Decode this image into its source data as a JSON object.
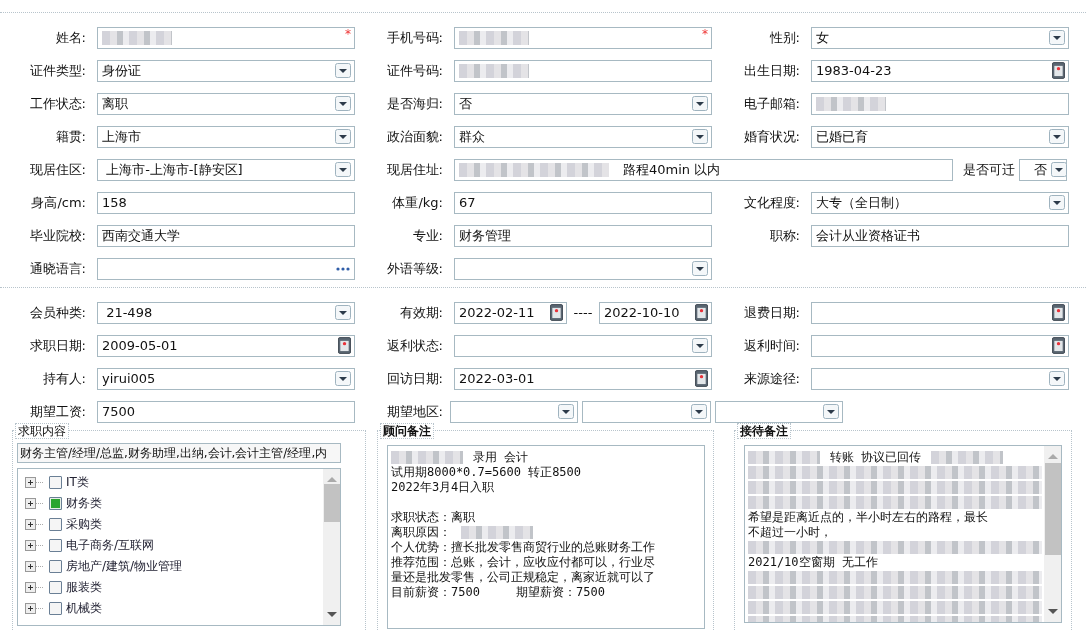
{
  "sections": [
    {
      "fields": [
        {
          "label": "姓名:",
          "kind": "text",
          "redacted": true,
          "required_mark": "*"
        },
        {
          "label": "手机号码:",
          "kind": "text",
          "redacted": true,
          "required_mark": "*"
        },
        {
          "label": "性别:",
          "kind": "select",
          "value": "女"
        },
        {
          "label": "证件类型:",
          "kind": "select",
          "value": "身份证"
        },
        {
          "label": "证件号码:",
          "kind": "text",
          "redacted": true
        },
        {
          "label": "出生日期:",
          "kind": "date",
          "value": "1983-04-23"
        },
        {
          "label": "工作状态:",
          "kind": "select",
          "value": "离职"
        },
        {
          "label": "是否海归:",
          "kind": "select",
          "value": "否"
        },
        {
          "label": "电子邮箱:",
          "kind": "text",
          "redacted": true
        },
        {
          "label": "籍贯:",
          "kind": "select",
          "value": "上海市"
        },
        {
          "label": "政治面貌:",
          "kind": "select",
          "value": "群众"
        },
        {
          "label": "婚育状况:",
          "kind": "select",
          "value": "已婚已育"
        },
        {
          "label": "现居住区:",
          "kind": "select",
          "value": " 上海市-上海市-[静安区]"
        },
        {
          "label": "现居住址:",
          "kind": "address",
          "redacted": true,
          "value": "路程40min 以内",
          "extra": {
            "label": "是否可迁",
            "value": "否"
          }
        },
        {
          "label": "身高/cm:",
          "kind": "text",
          "value": "158"
        },
        {
          "label": "体重/kg:",
          "kind": "text",
          "value": "67"
        },
        {
          "label": "文化程度:",
          "kind": "select",
          "value": "大专（全日制）"
        },
        {
          "label": "毕业院校:",
          "kind": "text",
          "value": "西南交通大学"
        },
        {
          "label": "专业:",
          "kind": "text",
          "value": "财务管理"
        },
        {
          "label": "职称:",
          "kind": "text",
          "value": "会计从业资格证书"
        },
        {
          "label": "通晓语言:",
          "kind": "lookup"
        },
        {
          "label": "外语等级:",
          "kind": "select"
        }
      ]
    },
    {
      "fields": [
        {
          "label": "会员种类:",
          "kind": "select",
          "value": " 21-498"
        },
        {
          "label": "有效期:",
          "kind": "date_range",
          "from": "2022-02-11",
          "separator": "----",
          "to": "2022-10-10"
        },
        {
          "label": "退费日期:",
          "kind": "date"
        },
        {
          "label": "求职日期:",
          "kind": "date",
          "value": "2009-05-01"
        },
        {
          "label": "返利状态:",
          "kind": "select"
        },
        {
          "label": "返利时间:",
          "kind": "date"
        },
        {
          "label": "持有人:",
          "kind": "select",
          "value": "yirui005"
        },
        {
          "label": "回访日期:",
          "kind": "date",
          "value": "2022-03-01"
        },
        {
          "label": "来源途径:",
          "kind": "select"
        },
        {
          "label": "期望工资:",
          "kind": "text",
          "value": "7500"
        },
        {
          "label": "期望地区:",
          "kind": "region",
          "parts": [
            {
              "kind": "select"
            },
            {
              "kind": "select"
            },
            {
              "kind": "select"
            }
          ]
        }
      ]
    }
  ],
  "job_panel": {
    "legend": "求职内容",
    "bold": false,
    "selection": "财务主管/经理/总监,财务助理,出纳,会计,会计主管/经理,内",
    "tree": [
      {
        "label": "IT类",
        "checked": false,
        "expanded": false
      },
      {
        "label": "财务类",
        "checked": true,
        "expanded": false
      },
      {
        "label": "采购类",
        "checked": false,
        "expanded": false
      },
      {
        "label": "电子商务/互联网",
        "checked": false,
        "expanded": false
      },
      {
        "label": "房地产/建筑/物业管理",
        "checked": false,
        "expanded": false
      },
      {
        "label": "服装类",
        "checked": false,
        "expanded": false
      },
      {
        "label": "机械类",
        "checked": false,
        "expanded": false
      }
    ]
  },
  "note_panels": [
    {
      "legend": "顾问备注",
      "bold": true,
      "scrollbar": false,
      "lines": [
        {
          "kind": "text",
          "segments": [
            {
              "kind": "redacted"
            },
            {
              "kind": "text",
              "text": "录用 会计"
            }
          ]
        },
        {
          "kind": "text",
          "segments": [
            {
              "kind": "text",
              "text": "试用期8000*0.7=5600 转正8500"
            }
          ]
        },
        {
          "kind": "text",
          "segments": [
            {
              "kind": "text",
              "text": "2022年3月4日入职"
            }
          ]
        },
        {
          "kind": "blank"
        },
        {
          "kind": "text",
          "segments": [
            {
              "kind": "text",
              "text": "求职状态：离职"
            }
          ]
        },
        {
          "kind": "text",
          "segments": [
            {
              "kind": "text",
              "text": "离职原因："
            },
            {
              "kind": "redacted"
            }
          ]
        },
        {
          "kind": "text",
          "segments": [
            {
              "kind": "text",
              "text": "个人优势：擅长批发零售商贸行业的总账财务工作"
            }
          ]
        },
        {
          "kind": "text",
          "segments": [
            {
              "kind": "text",
              "text": "推荐范围：总账，会计，应收应付都可以，行业尽"
            }
          ]
        },
        {
          "kind": "text",
          "segments": [
            {
              "kind": "text",
              "text": "量还是批发零售，公司正规稳定，离家近就可以了"
            }
          ]
        },
        {
          "kind": "text",
          "segments": [
            {
              "kind": "text",
              "text": "目前薪资：7500     期望薪资：7500"
            }
          ]
        }
      ]
    },
    {
      "legend": "接待备注",
      "bold": true,
      "scrollbar": true,
      "lines": [
        {
          "kind": "text",
          "segments": [
            {
              "kind": "redacted"
            },
            {
              "kind": "text",
              "text": "转账 协议已回传"
            },
            {
              "kind": "redacted"
            }
          ]
        },
        {
          "kind": "redacted"
        },
        {
          "kind": "redacted"
        },
        {
          "kind": "redacted"
        },
        {
          "kind": "text",
          "segments": [
            {
              "kind": "text",
              "text": "希望是距离近点的，半小时左右的路程，最长"
            }
          ]
        },
        {
          "kind": "text",
          "segments": [
            {
              "kind": "text",
              "text": "不超过一小时，"
            }
          ]
        },
        {
          "kind": "redacted"
        },
        {
          "kind": "text",
          "segments": [
            {
              "kind": "text",
              "text": "2021/10空窗期 无工作"
            }
          ]
        },
        {
          "kind": "redacted"
        },
        {
          "kind": "redacted"
        },
        {
          "kind": "redacted"
        },
        {
          "kind": "redacted"
        }
      ]
    }
  ]
}
